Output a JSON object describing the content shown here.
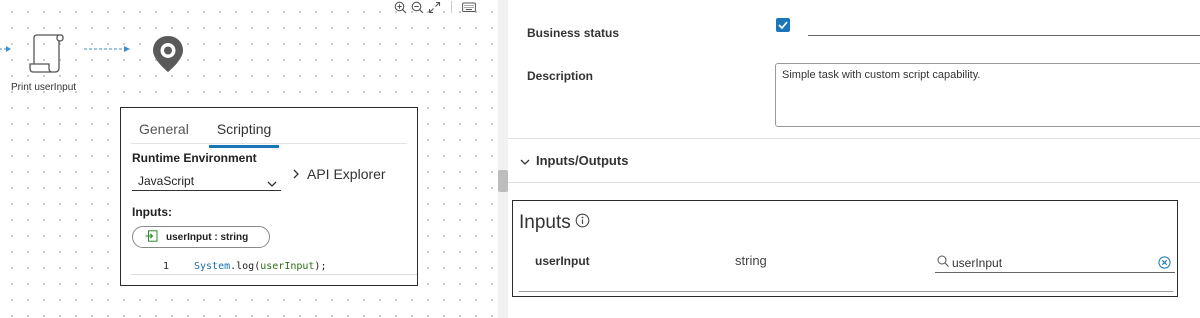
{
  "canvas": {
    "node_label": "Print userInput",
    "tools": [
      "zoom-in-icon",
      "zoom-out-icon",
      "fit-screen-icon",
      "keyboard-icon"
    ]
  },
  "popup": {
    "tabs": [
      {
        "label": "General",
        "active": false
      },
      {
        "label": "Scripting",
        "active": true
      }
    ],
    "runtime_label": "Runtime Environment",
    "runtime_value": "JavaScript",
    "api_explorer": "API Explorer",
    "inputs_label": "Inputs:",
    "input_chip": "userInput : string",
    "code": {
      "line_number": "1",
      "object": "System",
      "method": ".log(",
      "argument": "userInput",
      "suffix": ");"
    }
  },
  "panel": {
    "business_status_label": "Business status",
    "business_status_checked": true,
    "description_label": "Description",
    "description_value": "Simple task with custom script capability.",
    "section_title": "Inputs/Outputs",
    "inputs_title": "Inputs",
    "input_row": {
      "name": "userInput",
      "type": "string",
      "value": "userInput"
    }
  },
  "colors": {
    "accent": "#1b76b8",
    "node": "#5a5a5a",
    "connector": "#3d8fd0"
  }
}
